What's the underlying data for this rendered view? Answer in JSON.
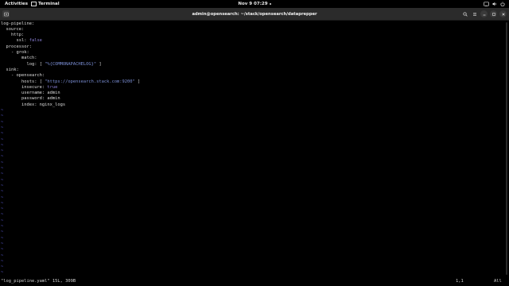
{
  "topbar": {
    "activities": "Activities",
    "app_name": "Terminal",
    "clock": "Nov 9  07:29",
    "status_icons": [
      "network-icon",
      "volume-icon",
      "power-icon"
    ]
  },
  "window": {
    "title": "admin@opensearch: ~/stack/opensearch/dataprepper",
    "buttons": [
      "search-icon",
      "menu-icon",
      "minimize-icon",
      "maximize-icon",
      "close-icon"
    ]
  },
  "editor": {
    "lines": [
      [
        {
          "t": "log-pipeline:",
          "c": "k"
        }
      ],
      [
        {
          "t": "  source:",
          "c": "k"
        }
      ],
      [
        {
          "t": "    http:",
          "c": "k"
        }
      ],
      [
        {
          "t": "      ssl: ",
          "c": "k"
        },
        {
          "t": "false",
          "c": "bool"
        }
      ],
      [
        {
          "t": "  processor:",
          "c": "k"
        }
      ],
      [
        {
          "t": "    - grok:",
          "c": "k"
        }
      ],
      [
        {
          "t": "        match:",
          "c": "k"
        }
      ],
      [
        {
          "t": "          log: ",
          "c": "k"
        },
        {
          "t": "[ ",
          "c": "br"
        },
        {
          "t": "\"%{COMMONAPACHELOG}\"",
          "c": "str"
        },
        {
          "t": " ]",
          "c": "br"
        }
      ],
      [
        {
          "t": "  sink:",
          "c": "k"
        }
      ],
      [
        {
          "t": "    - opensearch:",
          "c": "k"
        }
      ],
      [
        {
          "t": "        hosts: ",
          "c": "k"
        },
        {
          "t": "[ ",
          "c": "br"
        },
        {
          "t": "\"https://opensearch.stack.com:9200\"",
          "c": "str"
        },
        {
          "t": " ]",
          "c": "br"
        }
      ],
      [
        {
          "t": "        insecure: ",
          "c": "k"
        },
        {
          "t": "true",
          "c": "bool"
        }
      ],
      [
        {
          "t": "        username: admin",
          "c": "k"
        }
      ],
      [
        {
          "t": "        password: admin",
          "c": "k"
        }
      ],
      [
        {
          "t": "        index: nginx_logs",
          "c": "k"
        }
      ]
    ],
    "empty_marker": "~",
    "empty_line_count": 29
  },
  "status": {
    "file_info": "\"log_pipeline.yaml\" 15L, 309B",
    "cursor_pos": "1,1",
    "scroll_pct": "All"
  }
}
